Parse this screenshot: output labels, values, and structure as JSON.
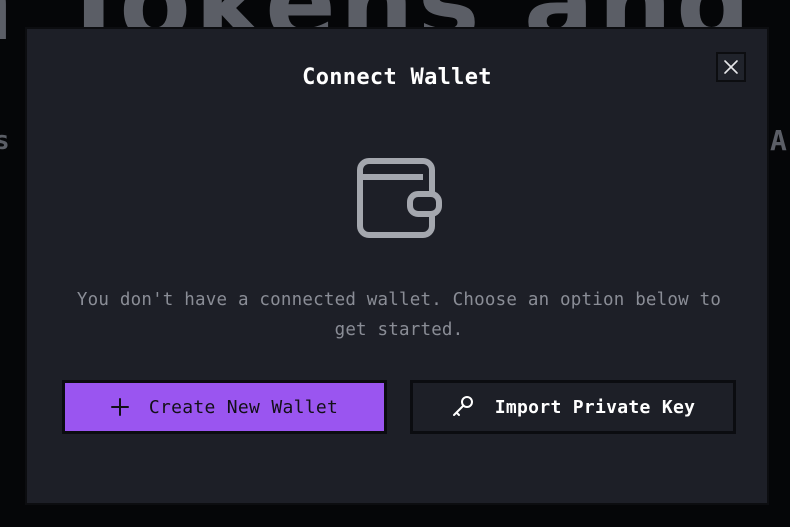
{
  "background": {
    "heading": "n Tokens and A",
    "sub_left": "s",
    "sub_right": "A"
  },
  "modal": {
    "title": "Connect Wallet",
    "close_icon": "close-icon",
    "illustration_icon": "wallet-icon",
    "message": "You don't have a connected wallet. Choose an option below to get started.",
    "buttons": {
      "create": {
        "label": "Create New Wallet",
        "icon": "plus-icon"
      },
      "import": {
        "label": "Import Private Key",
        "icon": "key-icon"
      }
    }
  },
  "colors": {
    "modal_bg": "#1d1f27",
    "accent": "#9a55f0",
    "text_primary": "#ffffff",
    "text_muted": "#8a8d96",
    "icon_gray": "#a4a7ae"
  }
}
